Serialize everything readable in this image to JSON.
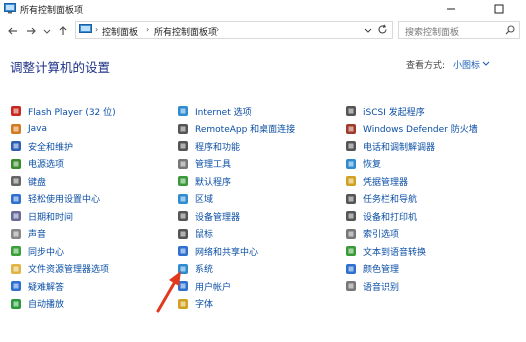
{
  "window": {
    "title": "所有控制面板项"
  },
  "address": {
    "crumbs": [
      "控制面板",
      "所有控制面板项"
    ]
  },
  "search": {
    "placeholder": "搜索控制面板"
  },
  "heading": "调整计算机的设置",
  "view": {
    "label": "查看方式:",
    "value": "小图标"
  },
  "columns": [
    [
      {
        "label": "Flash Player (32 位)",
        "icon": "flash-icon",
        "color": "#c8281e"
      },
      {
        "label": "Java",
        "icon": "java-icon",
        "color": "#d5791e"
      },
      {
        "label": "安全和维护",
        "icon": "flag-icon",
        "color": "#2d5fb4"
      },
      {
        "label": "电源选项",
        "icon": "power-icon",
        "color": "#3a8b2e"
      },
      {
        "label": "键盘",
        "icon": "keyboard-icon",
        "color": "#666666"
      },
      {
        "label": "轻松使用设置中心",
        "icon": "ease-of-access-icon",
        "color": "#2e6fd0"
      },
      {
        "label": "日期和时间",
        "icon": "clock-icon",
        "color": "#6b6b9a"
      },
      {
        "label": "声音",
        "icon": "speaker-icon",
        "color": "#888888"
      },
      {
        "label": "同步中心",
        "icon": "sync-icon",
        "color": "#3aa13a"
      },
      {
        "label": "文件资源管理器选项",
        "icon": "folder-options-icon",
        "color": "#e0b442"
      },
      {
        "label": "疑难解答",
        "icon": "troubleshoot-icon",
        "color": "#2e6fd0"
      },
      {
        "label": "自动播放",
        "icon": "autoplay-icon",
        "color": "#2a9a3a"
      }
    ],
    [
      {
        "label": "Internet 选项",
        "icon": "internet-icon",
        "color": "#2e8bd0"
      },
      {
        "label": "RemoteApp 和桌面连接",
        "icon": "remoteapp-icon",
        "color": "#555555"
      },
      {
        "label": "程序和功能",
        "icon": "programs-icon",
        "color": "#555555"
      },
      {
        "label": "管理工具",
        "icon": "admin-tools-icon",
        "color": "#777777"
      },
      {
        "label": "默认程序",
        "icon": "default-programs-icon",
        "color": "#3a9a3a"
      },
      {
        "label": "区域",
        "icon": "region-icon",
        "color": "#2e8bd0"
      },
      {
        "label": "设备管理器",
        "icon": "device-manager-icon",
        "color": "#555555"
      },
      {
        "label": "鼠标",
        "icon": "mouse-icon",
        "color": "#555555"
      },
      {
        "label": "网络和共享中心",
        "icon": "network-icon",
        "color": "#2e6fd0"
      },
      {
        "label": "系统",
        "icon": "system-icon",
        "color": "#2e8bd0"
      },
      {
        "label": "用户帐户",
        "icon": "user-accounts-icon",
        "color": "#2e6fd0"
      },
      {
        "label": "字体",
        "icon": "fonts-icon",
        "color": "#d0a020"
      }
    ],
    [
      {
        "label": "iSCSI 发起程序",
        "icon": "iscsi-icon",
        "color": "#555555"
      },
      {
        "label": "Windows Defender 防火墙",
        "icon": "firewall-icon",
        "color": "#a03a2a"
      },
      {
        "label": "电话和调制解调器",
        "icon": "phone-icon",
        "color": "#555555"
      },
      {
        "label": "恢复",
        "icon": "recovery-icon",
        "color": "#2e8bd0"
      },
      {
        "label": "凭据管理器",
        "icon": "credential-icon",
        "color": "#d0a020"
      },
      {
        "label": "任务栏和导航",
        "icon": "taskbar-icon",
        "color": "#555555"
      },
      {
        "label": "设备和打印机",
        "icon": "printer-icon",
        "color": "#555555"
      },
      {
        "label": "索引选项",
        "icon": "indexing-icon",
        "color": "#777777"
      },
      {
        "label": "文本到语音转换",
        "icon": "speech-icon",
        "color": "#3a9a3a"
      },
      {
        "label": "颜色管理",
        "icon": "color-management-icon",
        "color": "#2e6fd0"
      },
      {
        "label": "语音识别",
        "icon": "microphone-icon",
        "color": "#777777"
      }
    ]
  ],
  "colors": {
    "link": "#0b4fa5",
    "heading": "#1e3287",
    "annotation_arrow": "#e03a1e"
  }
}
